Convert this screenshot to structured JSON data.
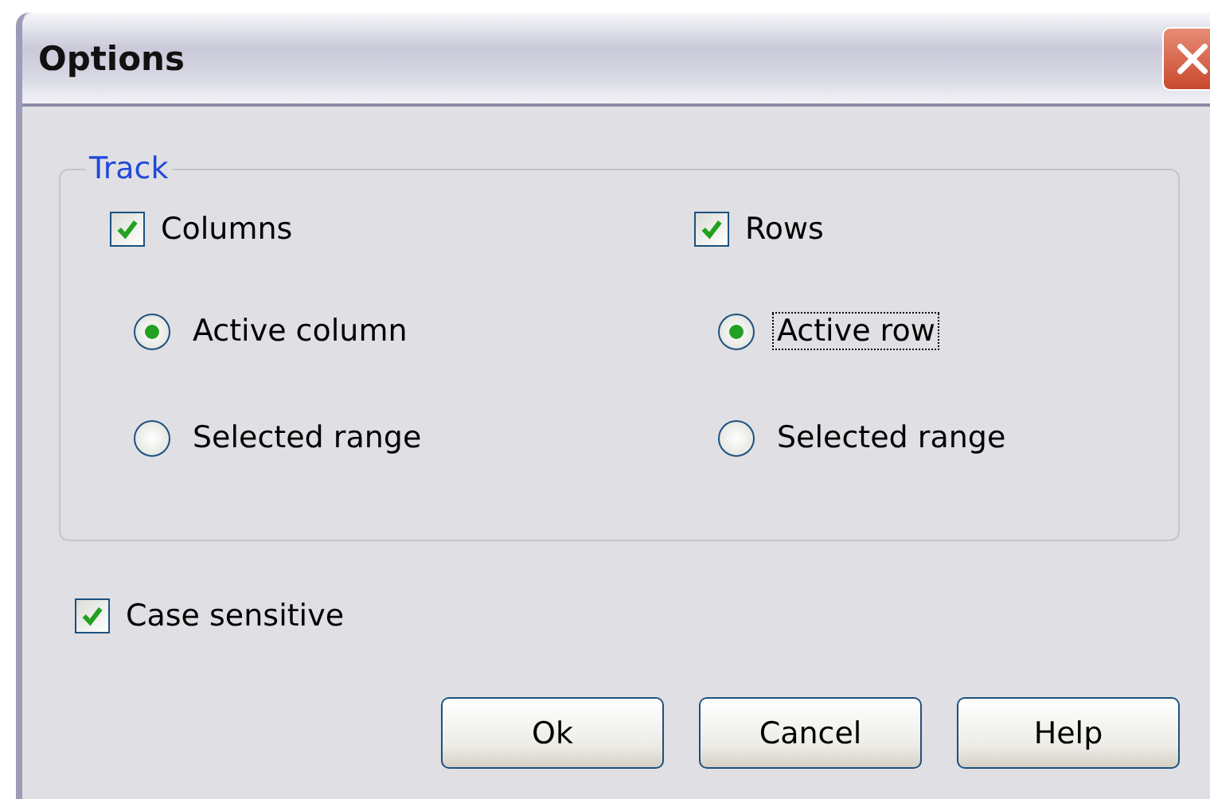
{
  "window": {
    "title": "Options"
  },
  "group": {
    "label": "Track",
    "columns": [
      {
        "checkbox": {
          "label": "Columns",
          "checked": true
        },
        "radios": [
          {
            "label": "Active column",
            "selected": true,
            "focused": false
          },
          {
            "label": "Selected range",
            "selected": false,
            "focused": false
          }
        ]
      },
      {
        "checkbox": {
          "label": "Rows",
          "checked": true
        },
        "radios": [
          {
            "label": "Active row",
            "selected": true,
            "focused": true
          },
          {
            "label": "Selected range",
            "selected": false,
            "focused": false
          }
        ]
      }
    ]
  },
  "case_sensitive": {
    "label": "Case sensitive",
    "checked": true
  },
  "buttons": [
    "Ok",
    "Cancel",
    "Help"
  ]
}
